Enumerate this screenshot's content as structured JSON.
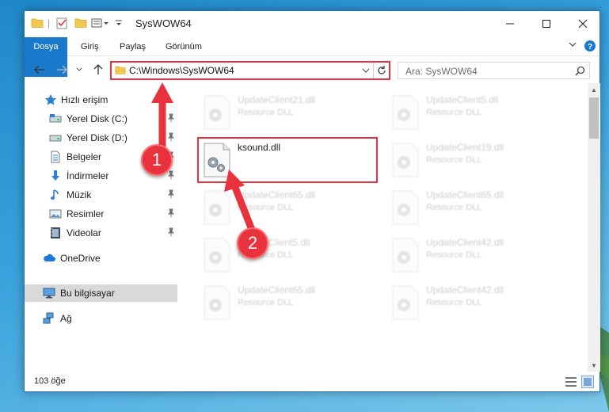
{
  "title_bar": {
    "title": "SysWOW64",
    "minimize_icon": "minimize-icon",
    "maximize_icon": "maximize-icon",
    "close_icon": "close-icon"
  },
  "ribbon": {
    "tabs": [
      "Dosya",
      "Giriş",
      "Paylaş",
      "Görünüm"
    ]
  },
  "address_bar": {
    "path": "C:\\Windows\\SysWOW64",
    "search_placeholder": "Ara: SysWOW64"
  },
  "sidebar": {
    "quick_access_label": "Hızlı erişim",
    "quick_items": [
      {
        "label": "Yerel Disk (C:)",
        "icon": "drive-icon",
        "pinned": true
      },
      {
        "label": "Yerel Disk (D:)",
        "icon": "drive-icon",
        "pinned": true
      },
      {
        "label": "Belgeler",
        "icon": "documents-icon",
        "pinned": true
      },
      {
        "label": "İndirmeler",
        "icon": "downloads-icon",
        "pinned": true
      },
      {
        "label": "Müzik",
        "icon": "music-icon",
        "pinned": true
      },
      {
        "label": "Resimler",
        "icon": "pictures-icon",
        "pinned": true
      },
      {
        "label": "Videolar",
        "icon": "videos-icon",
        "pinned": true
      }
    ],
    "onedrive_label": "OneDrive",
    "this_pc_label": "Bu bilgisayar",
    "network_label": "Ağ"
  },
  "files": {
    "highlighted": {
      "name": "ksound.dll"
    },
    "faded": [
      {
        "name": "UpdateClient21.dll",
        "type": "Resource DLL"
      },
      {
        "name": "UpdateClient5.dll",
        "type": "Resource DLL"
      },
      {
        "name": "UpdateClient19.dll",
        "type": "Resource DLL"
      },
      {
        "name": "UpdateClient65.dll",
        "type": "Resource DLL"
      },
      {
        "name": "UpdateClient65.dll",
        "type": "Resource DLL"
      },
      {
        "name": "UpdateClient5.dll",
        "type": "Resource DLL"
      },
      {
        "name": "UpdateClient42.dll",
        "type": "Resource DLL"
      },
      {
        "name": "UpdateClient65.dll",
        "type": "Resource DLL"
      },
      {
        "name": "UpdateClient42.dll",
        "type": "Resource DLL"
      }
    ]
  },
  "status_bar": {
    "item_count": "103 öğe"
  },
  "callouts": {
    "one": "1",
    "two": "2"
  },
  "colors": {
    "accent": "#1979ca",
    "highlight_red": "#e8323d",
    "selected_bg": "#d9d9d9"
  }
}
